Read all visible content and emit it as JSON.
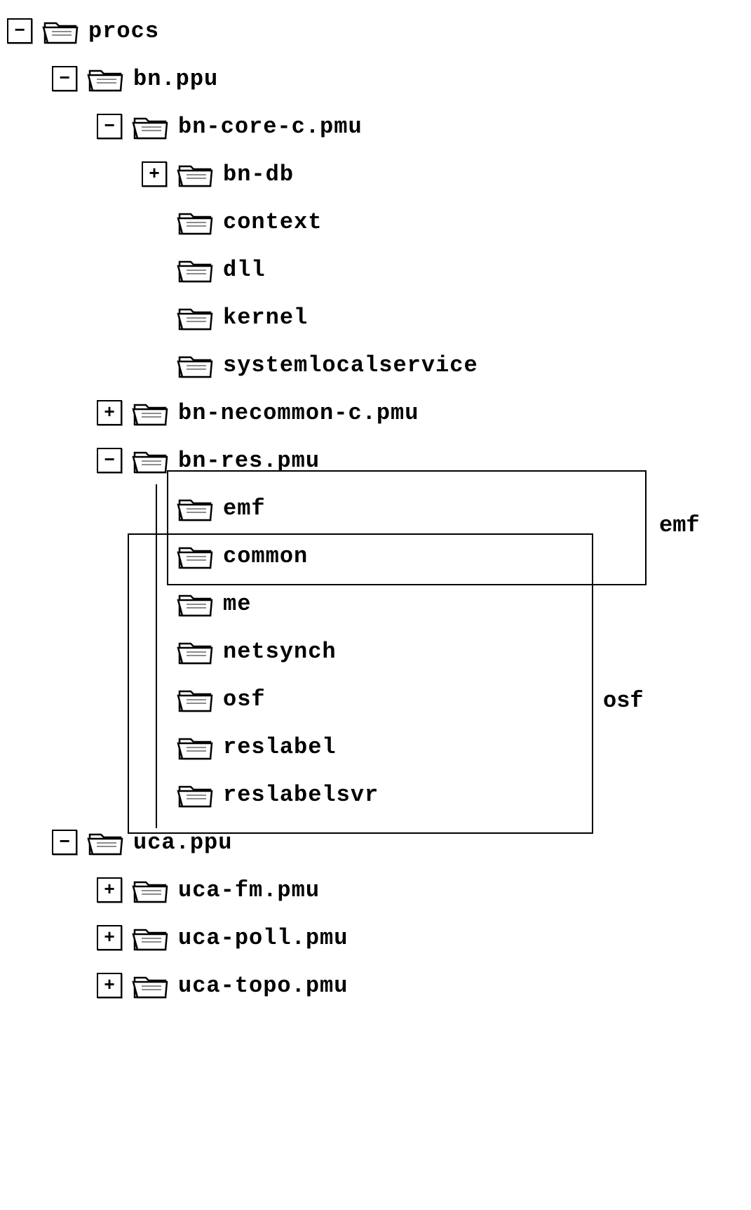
{
  "tree": {
    "root": {
      "label": "procs",
      "expander": "−"
    },
    "n1": {
      "label": "bn.ppu",
      "expander": "−"
    },
    "n1_1": {
      "label": "bn-core-c.pmu",
      "expander": "−"
    },
    "n1_1_1": {
      "label": "bn-db",
      "expander": "+"
    },
    "n1_1_2": {
      "label": "context"
    },
    "n1_1_3": {
      "label": "dll"
    },
    "n1_1_4": {
      "label": "kernel"
    },
    "n1_1_5": {
      "label": "systemlocalservice"
    },
    "n1_2": {
      "label": "bn-necommon-c.pmu",
      "expander": "+"
    },
    "n1_3": {
      "label": "bn-res.pmu",
      "expander": "−"
    },
    "n1_3_1": {
      "label": "emf"
    },
    "n1_3_2": {
      "label": "common"
    },
    "n1_3_3": {
      "label": "me"
    },
    "n1_3_4": {
      "label": "netsynch"
    },
    "n1_3_5": {
      "label": "osf"
    },
    "n1_3_6": {
      "label": "reslabel"
    },
    "n1_3_7": {
      "label": "reslabelsvr"
    },
    "n2": {
      "label": "uca.ppu",
      "expander": "−"
    },
    "n2_1": {
      "label": "uca-fm.pmu",
      "expander": "+"
    },
    "n2_2": {
      "label": "uca-poll.pmu",
      "expander": "+"
    },
    "n2_3": {
      "label": "uca-topo.pmu",
      "expander": "+"
    }
  },
  "groups": {
    "emf_label": "emf",
    "osf_label": "osf"
  }
}
